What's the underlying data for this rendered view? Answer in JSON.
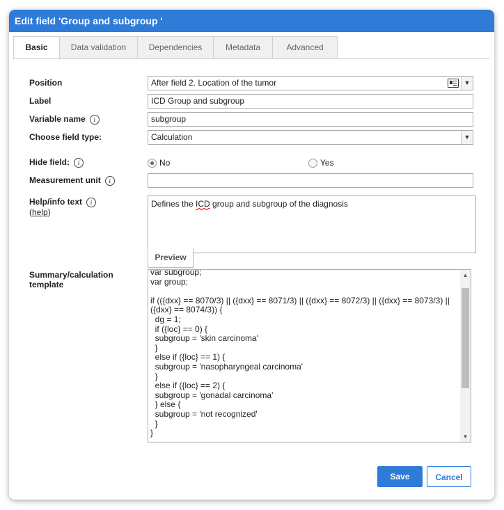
{
  "dialog": {
    "title": "Edit field 'Group and subgroup '"
  },
  "tabs": [
    {
      "label": "Basic"
    },
    {
      "label": "Data validation"
    },
    {
      "label": "Dependencies"
    },
    {
      "label": "Metadata"
    },
    {
      "label": "Advanced"
    }
  ],
  "form": {
    "position_label": "Position",
    "position_value": "After field 2. Location of the tumor",
    "label_label": "Label",
    "label_value": "ICD Group and subgroup",
    "variable_label": "Variable name",
    "variable_value": "subgroup",
    "type_label": "Choose field type:",
    "type_value": "Calculation",
    "hide_label": "Hide field:",
    "hide_no": "No",
    "hide_yes": "Yes",
    "hide_selected": "No",
    "unit_label": "Measurement unit",
    "unit_value": "",
    "help_label": "Help/info text",
    "help_open": "(",
    "help_link": "help",
    "help_close": ")",
    "help_text_before": "Defines the ",
    "help_text_spell": "ICD",
    "help_text_after": " group and subgroup of the diagnosis",
    "preview_label": "Preview",
    "template_label": "Summary/calculation template",
    "template_code": "var subgroup;\nvar group;\n\nif (({dxx} == 8070/3) || ({dxx} == 8071/3) || ({dxx} == 8072/3) || ({dxx} == 8073/3) ||\n({dxx} == 8074/3)) {\n  dg = 1;\n  if ({loc} == 0) {\n  subgroup = 'skin carcinoma'\n  }\n  else if ({loc} == 1) {\n  subgroup = 'nasopharyngeal carcinoma'\n  }\n  else if ({loc} == 2) {\n  subgroup = 'gonadal carcinoma'\n  } else {\n  subgroup = 'not recognized'\n  }\n}"
  },
  "buttons": {
    "save": "Save",
    "cancel": "Cancel"
  },
  "icons": {
    "info": "i",
    "dropdown": "▼",
    "scroll_up": "▲",
    "scroll_down": "▼"
  },
  "colors": {
    "accent": "#2f7bd8"
  }
}
